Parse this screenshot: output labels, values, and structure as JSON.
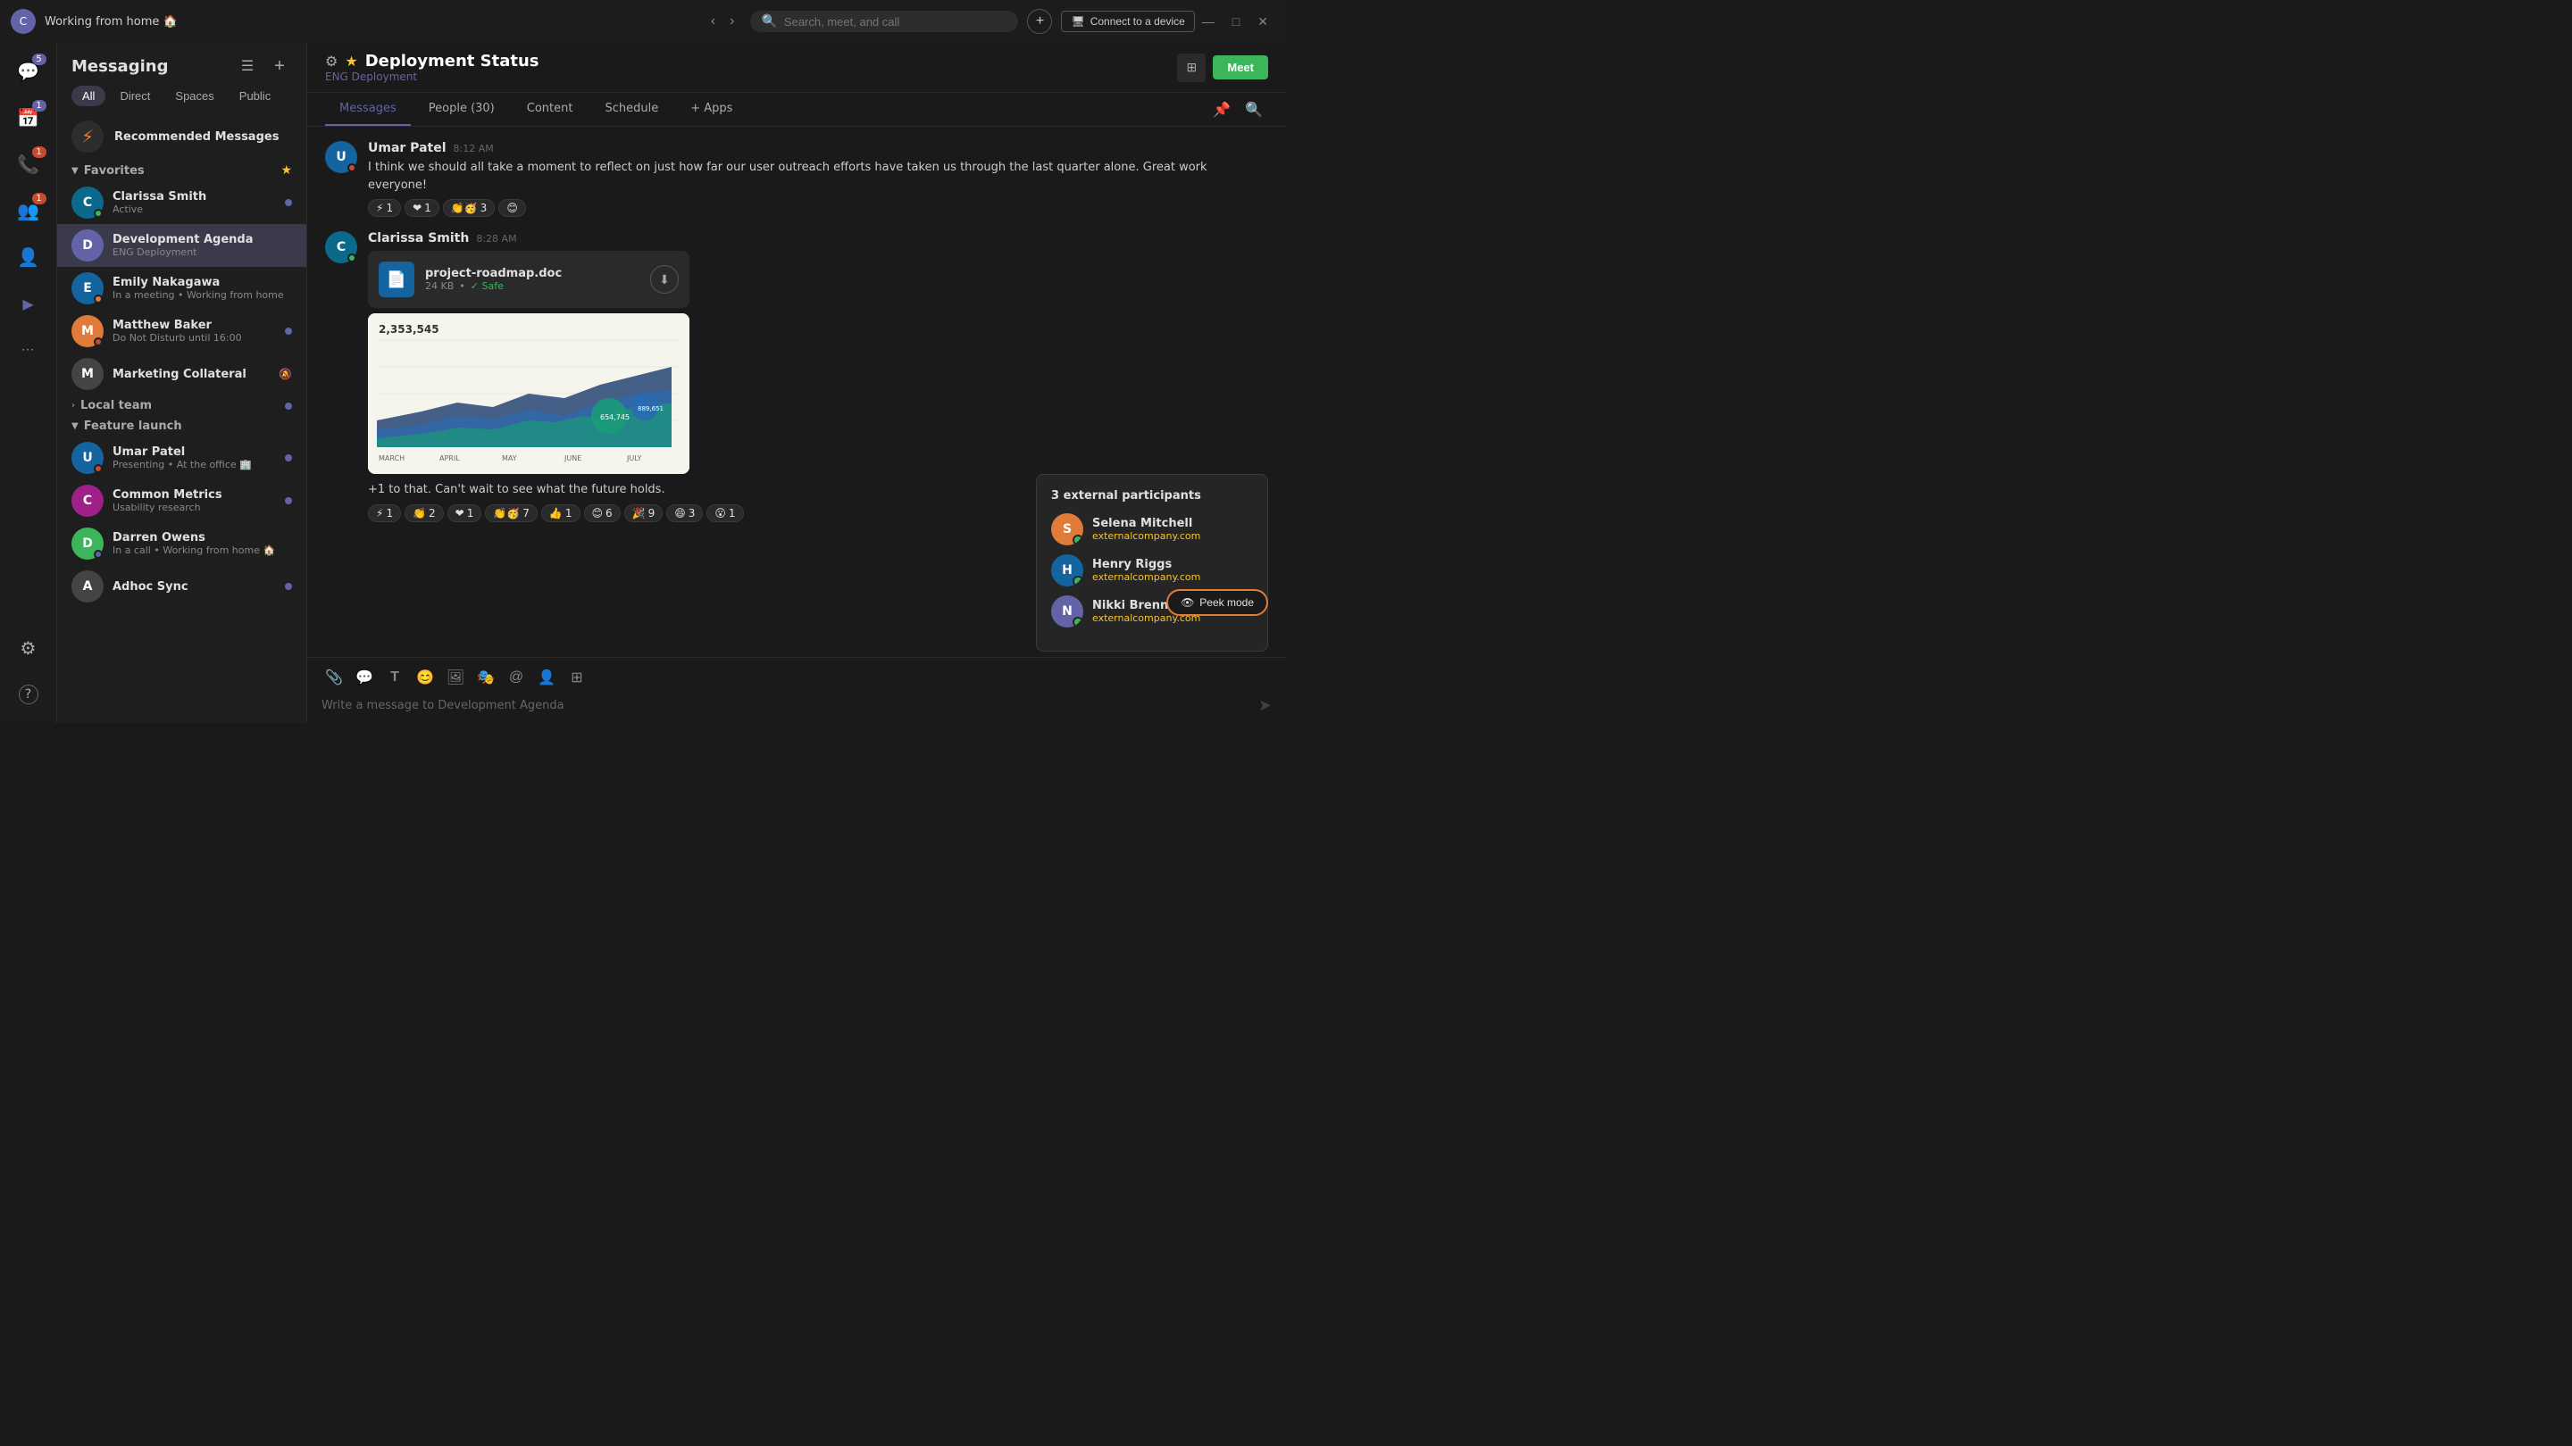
{
  "titleBar": {
    "userInitial": "C",
    "title": "Working from home 🏠",
    "searchPlaceholder": "Search, meet, and call",
    "addLabel": "+",
    "connectLabel": "Connect to a device",
    "minimizeLabel": "—",
    "maximizeLabel": "□",
    "closeLabel": "✕"
  },
  "iconRail": {
    "items": [
      {
        "id": "chat",
        "icon": "💬",
        "badge": "5",
        "badgeType": "purple"
      },
      {
        "id": "calendar",
        "icon": "📅",
        "badge": "1",
        "badgeType": "purple"
      },
      {
        "id": "calls",
        "icon": "📞",
        "badge": "1",
        "badgeType": "red"
      },
      {
        "id": "teams",
        "icon": "👥",
        "badge": "1",
        "badgeType": "red"
      },
      {
        "id": "contacts",
        "icon": "👤",
        "badge": null
      },
      {
        "id": "activity",
        "icon": "▶",
        "badge": null
      },
      {
        "id": "more",
        "icon": "···",
        "badge": null
      }
    ],
    "bottomItems": [
      {
        "id": "settings",
        "icon": "⚙",
        "badge": null
      },
      {
        "id": "help",
        "icon": "?",
        "badge": null
      }
    ]
  },
  "sidebar": {
    "title": "Messaging",
    "filterTabs": [
      "All",
      "Direct",
      "Spaces",
      "Public"
    ],
    "activeFilter": "All",
    "recommendedLabel": "Recommended Messages",
    "sections": {
      "favorites": {
        "label": "Favorites",
        "expanded": true,
        "contacts": [
          {
            "id": "clarissa",
            "name": "Clarissa Smith",
            "status": "Active",
            "statusType": "green",
            "avatarColor": "avatar-teal",
            "initial": "C",
            "hasImage": true,
            "unread": true,
            "starred": true
          },
          {
            "id": "development",
            "name": "Development Agenda",
            "status": "ENG Deployment",
            "statusType": "none",
            "avatarColor": "avatar-purple",
            "initial": "D",
            "hasImage": false,
            "unread": false,
            "active": true
          },
          {
            "id": "emily",
            "name": "Emily Nakagawa",
            "status": "In a meeting • Working from home",
            "statusType": "orange",
            "avatarColor": "avatar-blue",
            "initial": "E",
            "hasImage": true,
            "unread": false
          },
          {
            "id": "matthew",
            "name": "Matthew Baker",
            "status": "Do Not Disturb until 16:00",
            "statusType": "red",
            "avatarColor": "avatar-orange",
            "initial": "M",
            "hasImage": true,
            "unread": true
          },
          {
            "id": "marketing",
            "name": "Marketing Collateral",
            "status": "",
            "statusType": "none",
            "avatarColor": "avatar-dark",
            "initial": "M",
            "hasImage": false,
            "unread": false,
            "muted": true
          }
        ]
      },
      "localTeam": {
        "label": "Local team",
        "expanded": false,
        "unread": true
      },
      "featureLaunch": {
        "label": "Feature launch",
        "expanded": true,
        "contacts": [
          {
            "id": "umar",
            "name": "Umar Patel",
            "status": "Presenting • At the office 🏢",
            "statusType": "red",
            "avatarColor": "avatar-blue",
            "initial": "U",
            "hasImage": true,
            "unread": true
          },
          {
            "id": "common",
            "name": "Common Metrics",
            "status": "Usability research",
            "statusType": "none",
            "avatarColor": "avatar-magenta",
            "initial": "C",
            "hasImage": false,
            "unread": true
          },
          {
            "id": "darren",
            "name": "Darren Owens",
            "status": "In a call • Working from home 🏠",
            "statusType": "purple",
            "avatarColor": "avatar-green",
            "initial": "D",
            "hasImage": true,
            "unread": false
          },
          {
            "id": "adhoc",
            "name": "Adhoc Sync",
            "status": "",
            "statusType": "none",
            "avatarColor": "avatar-dark",
            "initial": "A",
            "hasImage": false,
            "unread": true
          }
        ]
      }
    }
  },
  "channel": {
    "name": "Deployment Status",
    "subLabel": "ENG Deployment",
    "tabs": [
      "Messages",
      "People (30)",
      "Content",
      "Schedule",
      "+ Apps"
    ],
    "activeTab": "Messages",
    "meetLabel": "Meet"
  },
  "messages": [
    {
      "id": "msg1",
      "author": "Umar Patel",
      "time": "8:12 AM",
      "avatarColor": "avatar-blue",
      "initial": "U",
      "text": "I think we should all take a moment to reflect on just how far our user outreach efforts have taken us through the last quarter alone. Great work everyone!",
      "reactions": [
        {
          "emoji": "⚡",
          "count": "1"
        },
        {
          "emoji": "❤",
          "count": "1"
        },
        {
          "emoji": "👏🥳",
          "count": "3"
        },
        {
          "emoji": "😊",
          "count": ""
        }
      ]
    },
    {
      "id": "msg2",
      "author": "Clarissa Smith",
      "time": "8:28 AM",
      "avatarColor": "avatar-teal",
      "initial": "C",
      "statusDot": "green",
      "file": {
        "name": "project-roadmap.doc",
        "size": "24 KB",
        "safeLabel": "Safe"
      },
      "chartValue": "2,353,545",
      "text": "+1 to that. Can't wait to see what the future holds.",
      "reactions": [
        {
          "emoji": "⚡",
          "count": "1"
        },
        {
          "emoji": "👏",
          "count": "2"
        },
        {
          "emoji": "❤",
          "count": "1"
        },
        {
          "emoji": "👏🥳",
          "count": "7"
        },
        {
          "emoji": "👍",
          "count": "1"
        },
        {
          "emoji": "😊",
          "count": "6"
        },
        {
          "emoji": "🎉",
          "count": "9"
        },
        {
          "emoji": "😄",
          "count": "3"
        },
        {
          "emoji": "😮",
          "count": "1"
        }
      ]
    }
  ],
  "inputArea": {
    "placeholder": "Write a message to Development Agenda",
    "tools": [
      "📎",
      "💬",
      "T",
      "😊",
      "🖼",
      "🎭",
      "@",
      "👤",
      "⊞"
    ]
  },
  "externalParticipants": {
    "title": "3 external participants",
    "people": [
      {
        "name": "Selena Mitchell",
        "email": "externalcompany.com",
        "avatarColor": "avatar-orange",
        "initial": "S"
      },
      {
        "name": "Henry Riggs",
        "email": "externalcompany.com",
        "avatarColor": "avatar-blue",
        "initial": "H"
      },
      {
        "name": "Nikki Brennan",
        "email": "externalcompany.com",
        "avatarColor": "avatar-purple",
        "initial": "N"
      }
    ]
  },
  "peekMode": {
    "label": "Peek mode",
    "icon": "👁"
  }
}
